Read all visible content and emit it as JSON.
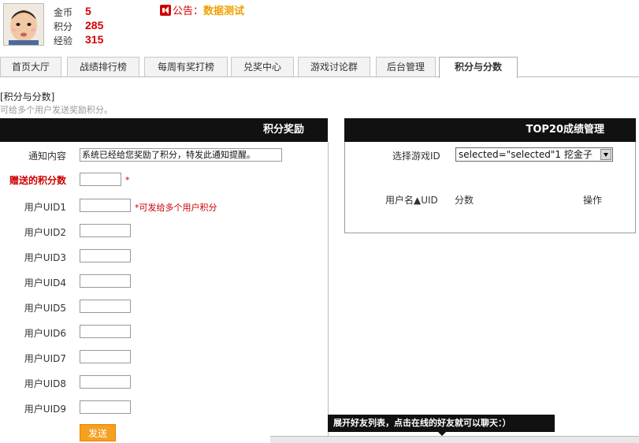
{
  "user": {
    "stats": [
      {
        "label": "金币",
        "value": "5"
      },
      {
        "label": "积分",
        "value": "285"
      },
      {
        "label": "经验",
        "value": "315"
      }
    ]
  },
  "notice": {
    "prefix": "公告：",
    "message": "数据测试"
  },
  "tabs": [
    "首页大厅",
    "战绩排行榜",
    "每周有奖打榜",
    "兑奖中心",
    "游戏讨论群",
    "后台管理",
    "积分与分数"
  ],
  "active_tab": "积分与分数",
  "breadcrumb": "[积分与分数]",
  "description": "可给多个用户发送奖励积分。",
  "reward_panel": {
    "title": "积分奖励",
    "notice_label": "通知内容",
    "notice_value": "系统已经给您奖励了积分，特发此通知提醒。",
    "points_label": "赠送的积分数",
    "points_required": "*",
    "uid_hint": "*可发给多个用户积分",
    "uid_labels": [
      "用户UID1",
      "用户UID2",
      "用户UID3",
      "用户UID4",
      "用户UID5",
      "用户UID6",
      "用户UID7",
      "用户UID8",
      "用户UID9"
    ],
    "send_label": "发送"
  },
  "top20_panel": {
    "title": "TOP20成绩管理",
    "select_label": "选择游戏ID",
    "select_value": "selected=\"selected\"1 挖金子",
    "col_username": "用户名▲UID",
    "col_score": "分数",
    "col_action": "操作"
  },
  "friend_tip": "展开好友列表，点击在线的好友就可以聊天：）"
}
